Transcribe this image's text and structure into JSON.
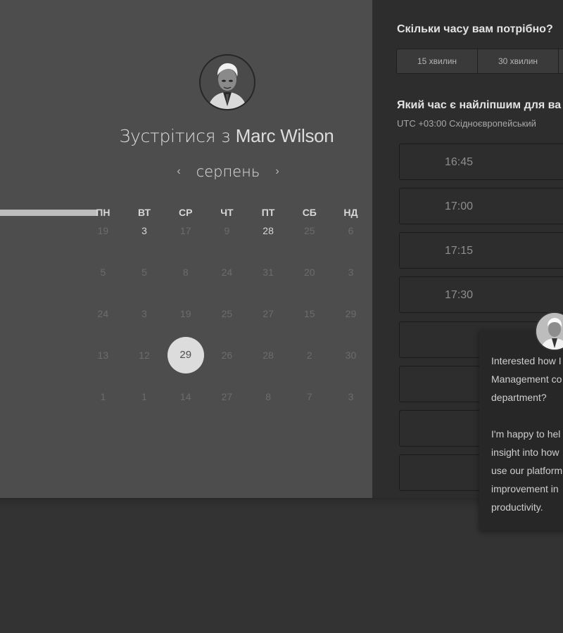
{
  "host": {
    "title_prefix": "Зустрітися з",
    "name": "Marc Wilson"
  },
  "calendar": {
    "month": "серпень",
    "prev_icon": "chevron-left-icon",
    "next_icon": "chevron-right-icon",
    "weekdays": [
      "ПН",
      "ВТ",
      "СР",
      "ЧТ",
      "ПТ",
      "СБ",
      "НД"
    ],
    "weeks": [
      [
        "19",
        "3",
        "17",
        "9",
        "28",
        "25",
        "6"
      ],
      [
        "5",
        "5",
        "8",
        "24",
        "31",
        "20",
        "3"
      ],
      [
        "24",
        "3",
        "19",
        "25",
        "27",
        "15",
        "29"
      ],
      [
        "13",
        "12",
        "29",
        "26",
        "28",
        "2",
        "30"
      ],
      [
        "1",
        "1",
        "14",
        "27",
        "8",
        "7",
        "3"
      ]
    ],
    "selected_day": "29"
  },
  "duration": {
    "question": "Скільки часу вам потрібно?",
    "options": [
      "15 хвилин",
      "30 хвилин"
    ]
  },
  "time_selection": {
    "question": "Який час є найліпшим для ва",
    "timezone": "UTC +03:00 Східноєвропейський",
    "slots": [
      "16:45",
      "17:00",
      "17:15",
      "17:30",
      "",
      "",
      ""
    ]
  },
  "chat": {
    "message_lines_1": [
      "Interested how I",
      "Management co",
      "department?"
    ],
    "message_lines_2": [
      "I'm happy to hel",
      "insight into how",
      "use our platform",
      "improvement in",
      "productivity."
    ]
  },
  "colors": {
    "left_panel": "#4d4d4d",
    "right_panel": "#2d2d2d",
    "selected_day_bg": "#dcdcdc"
  }
}
